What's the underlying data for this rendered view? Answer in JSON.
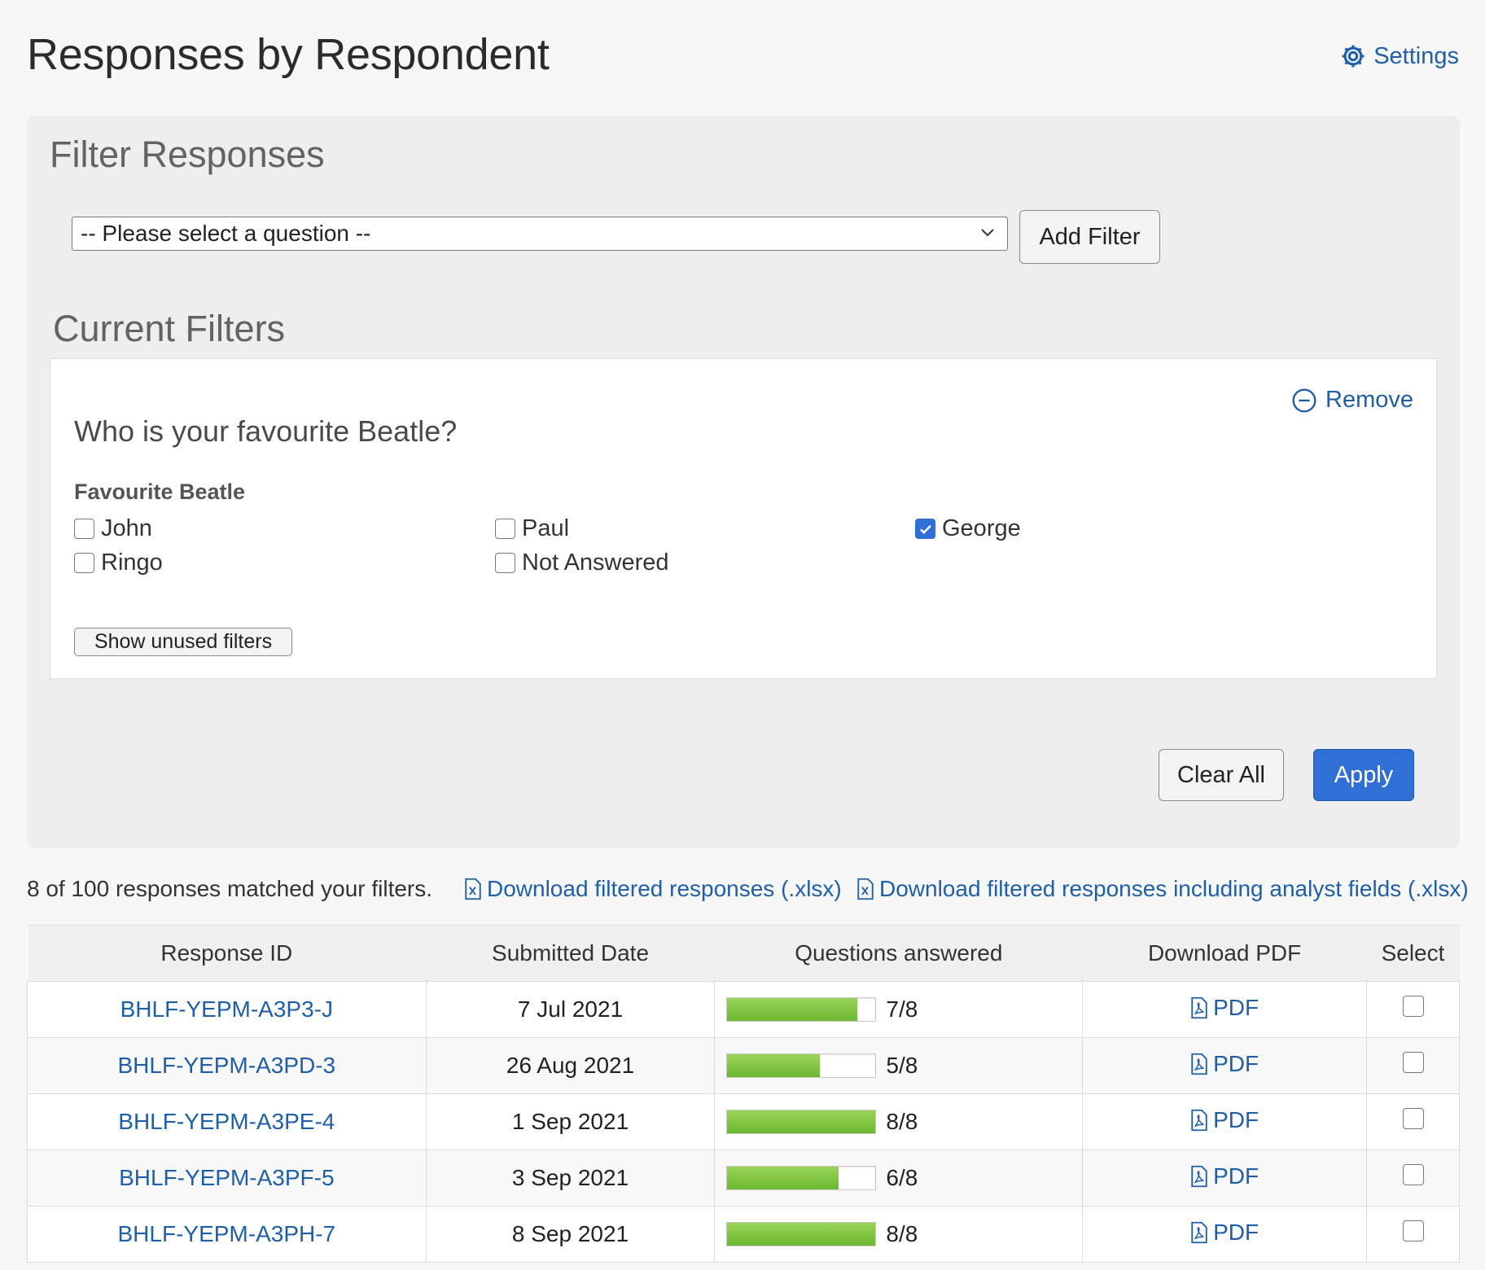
{
  "header": {
    "title": "Responses by Respondent",
    "settings_label": "Settings"
  },
  "filter_panel": {
    "heading": "Filter Responses",
    "question_select": "-- Please select a question --",
    "add_filter_label": "Add Filter",
    "current_heading": "Current Filters",
    "clear_all_label": "Clear All",
    "apply_label": "Apply"
  },
  "current_filter": {
    "remove_label": "Remove",
    "question": "Who is your favourite Beatle?",
    "field_label": "Favourite Beatle",
    "options": [
      {
        "label": "John",
        "checked": false
      },
      {
        "label": "Paul",
        "checked": false
      },
      {
        "label": "George",
        "checked": true
      },
      {
        "label": "Ringo",
        "checked": false
      },
      {
        "label": "Not Answered",
        "checked": false
      }
    ],
    "show_unused_label": "Show unused filters"
  },
  "results": {
    "match_text": "8 of 100 responses matched your filters.",
    "download_xlsx": "Download filtered responses (.xlsx)",
    "download_xlsx_analyst": "Download filtered responses including analyst fields (.xlsx)"
  },
  "table": {
    "headers": [
      "Response ID",
      "Submitted Date",
      "Questions answered",
      "Download PDF",
      "Select"
    ],
    "pdf_label": "PDF",
    "rows": [
      {
        "id": "BHLF-YEPM-A3P3-J",
        "date": "7 Jul 2021",
        "answered": "7/8",
        "fraction": 0.875
      },
      {
        "id": "BHLF-YEPM-A3PD-3",
        "date": "26 Aug 2021",
        "answered": "5/8",
        "fraction": 0.625
      },
      {
        "id": "BHLF-YEPM-A3PE-4",
        "date": "1 Sep 2021",
        "answered": "8/8",
        "fraction": 1.0
      },
      {
        "id": "BHLF-YEPM-A3PF-5",
        "date": "3 Sep 2021",
        "answered": "6/8",
        "fraction": 0.75
      },
      {
        "id": "BHLF-YEPM-A3PH-7",
        "date": "8 Sep 2021",
        "answered": "8/8",
        "fraction": 1.0
      }
    ]
  },
  "colors": {
    "link": "#1f5fa8",
    "primary_button": "#2f6fd6",
    "progress_fill": "#7cc242"
  }
}
